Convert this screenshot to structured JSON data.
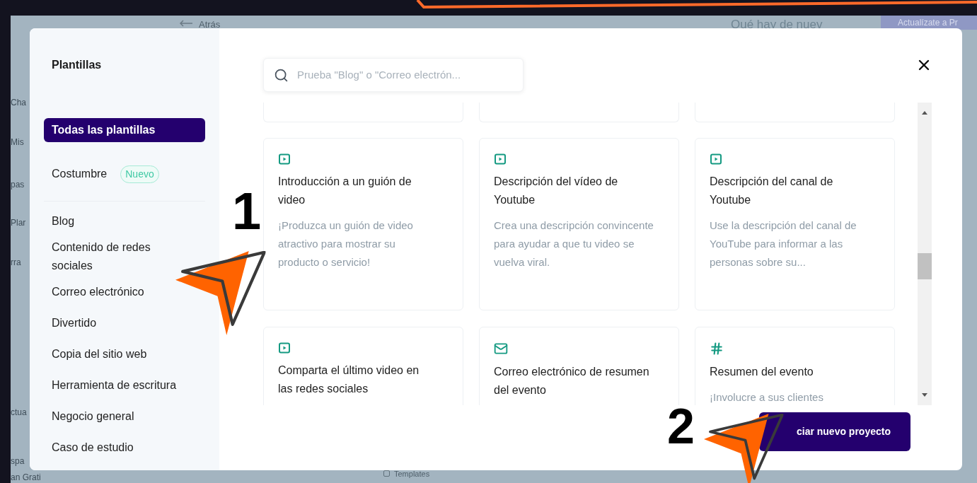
{
  "background": {
    "back_link": "Atrás",
    "whats_new": "Qué hay de nuev",
    "upgrade_button": "Actualízate a Pr",
    "sidebar_fragments": [
      "Cha",
      "Mis",
      "pas",
      "Plar",
      "rra",
      "ctua",
      "spa",
      "an Grati"
    ],
    "templates_label": "Templates"
  },
  "modal": {
    "title": "Plantillas",
    "category_groups": [
      {
        "items": [
          {
            "label": "Todas las plantillas",
            "selected": true
          }
        ]
      },
      {
        "items": [
          {
            "label": "Costumbre",
            "badge": "Nuevo",
            "selected": false
          }
        ]
      },
      {
        "items": [
          {
            "label": "Blog",
            "selected": false
          },
          {
            "label": "Contenido de redes sociales",
            "selected": false
          },
          {
            "label": "Correo electrónico",
            "selected": false
          },
          {
            "label": "Divertido",
            "selected": false
          },
          {
            "label": "Copia del sitio web",
            "selected": false
          },
          {
            "label": "Herramienta de escritura",
            "selected": false
          },
          {
            "label": "Negocio general",
            "selected": false
          },
          {
            "label": "Caso de estudio",
            "selected": false
          }
        ]
      }
    ],
    "search": {
      "placeholder": "Prueba \"Blog\" o \"Correo electrón..."
    },
    "cards": [
      {
        "kind": "video",
        "title": "Introducción a un guión de video",
        "description": "¡Produzca un guión de video atractivo para mostrar su producto o servicio!"
      },
      {
        "kind": "video",
        "title": "Descripción del vídeo de Youtube",
        "description": "Crea una descripción convincente para ayudar a que tu video se vuelva viral."
      },
      {
        "kind": "video",
        "title": "Descripción del canal de Youtube",
        "description": "Use la descripción del canal de YouTube para informar a las personas sobre su..."
      },
      {
        "kind": "video",
        "title": "Comparta el último video en las redes sociales"
      },
      {
        "kind": "mail",
        "title": "Correo electrónico de resumen del evento"
      },
      {
        "kind": "hash",
        "title": "Resumen del evento",
        "description": "¡Involucre a sus clientes"
      }
    ],
    "primary_button": "ciar nuevo proyecto"
  },
  "annotations": [
    {
      "number": "1"
    },
    {
      "number": "2"
    }
  ]
}
